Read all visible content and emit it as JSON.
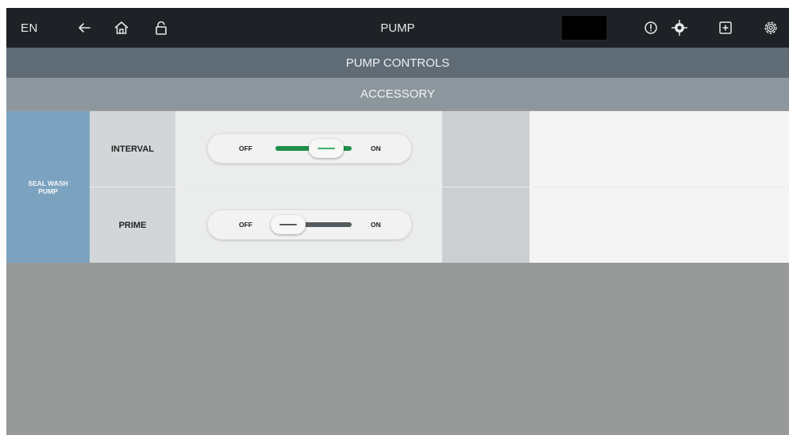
{
  "topbar": {
    "language": "EN",
    "title": "PUMP",
    "icons": [
      "back-arrow-icon",
      "home-icon",
      "lock-icon",
      "alert-icon",
      "target-icon",
      "add-box-icon",
      "settings-icon"
    ]
  },
  "sections": {
    "primary": "PUMP CONTROLS",
    "secondary": "ACCESSORY"
  },
  "group": {
    "label": "SEAL WASH PUMP"
  },
  "rows": [
    {
      "label": "INTERVAL",
      "off_label": "OFF",
      "on_label": "ON",
      "state": "ON"
    },
    {
      "label": "PRIME",
      "off_label": "OFF",
      "on_label": "ON",
      "state": "OFF"
    }
  ],
  "colors": {
    "toggle_on": "#1f8f4a",
    "toggle_off": "#555a5e",
    "topbar": "#1e2125",
    "group": "#7ba3bf"
  }
}
